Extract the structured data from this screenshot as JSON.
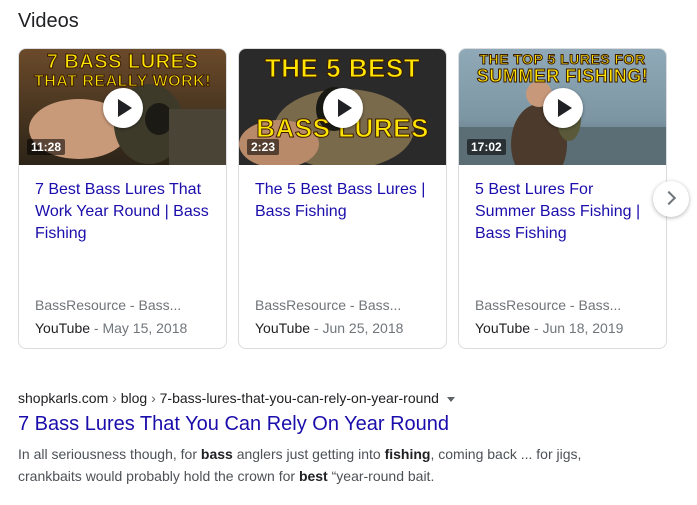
{
  "section_title": "Videos",
  "videos": [
    {
      "thumb_caption_1": "7 BASS LURES",
      "thumb_caption_2": "THAT REALLY WORK!",
      "duration": "11:28",
      "title": "7 Best Bass Lures That Work Year Round | Bass Fishing",
      "source": "BassResource - Bass...",
      "platform": "YouTube",
      "date": " - May 15, 2018"
    },
    {
      "thumb_caption_1": "THE 5 BEST",
      "thumb_caption_2": "BASS LURES",
      "duration": "2:23",
      "title": "The 5 Best Bass Lures | Bass Fishing",
      "source": "BassResource - Bass...",
      "platform": "YouTube",
      "date": " - Jun 25, 2018"
    },
    {
      "thumb_caption_1": "THE TOP 5 LURES FOR",
      "thumb_caption_2": "SUMMER FISHING!",
      "duration": "17:02",
      "title": "5 Best Lures For Summer Bass Fishing | Bass Fishing",
      "source": "BassResource - Bass...",
      "platform": "YouTube",
      "date": " - Jun 18, 2019"
    }
  ],
  "result": {
    "url_domain": "shopkarls.com",
    "url_sep_1": " › ",
    "url_part_1": "blog",
    "url_sep_2": " › ",
    "url_part_2": "7-bass-lures-that-you-can-rely-on-year-round",
    "title": "7 Bass Lures That You Can Rely On Year Round",
    "snippet": {
      "s1": "In all seriousness though, for ",
      "b1": "bass",
      "s2": " anglers just getting into ",
      "b2": "fishing",
      "s3": ", coming back ... for jigs, crankbaits would probably hold the crown for ",
      "b3": "best",
      "s4": " “year-round bait."
    }
  },
  "icons": {
    "play": "play-icon",
    "next": "chevron-right-icon",
    "menu": "caret-down-icon"
  }
}
